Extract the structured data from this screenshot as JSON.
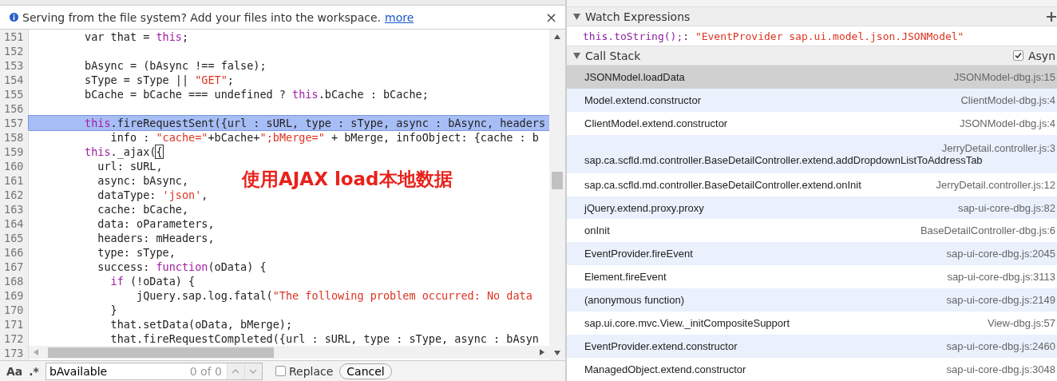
{
  "infobar": {
    "message": "Serving from the file system? Add your files into the workspace.",
    "link": "more",
    "close": "×"
  },
  "editor": {
    "lines": [
      {
        "number": "151",
        "selected": false,
        "tokens": [
          {
            "kind": "plain",
            "text": "        var that = "
          },
          {
            "kind": "keyword",
            "text": "this"
          },
          {
            "kind": "plain",
            "text": ";"
          }
        ]
      },
      {
        "number": "152",
        "selected": false
      },
      {
        "number": "153",
        "selected": false,
        "tokens": [
          {
            "kind": "plain",
            "text": "        bAsync = (bAsync !== false);"
          }
        ]
      },
      {
        "number": "154",
        "selected": false,
        "tokens": [
          {
            "kind": "plain",
            "text": "        sType = sType || "
          },
          {
            "kind": "string",
            "text": "\"GET\""
          },
          {
            "kind": "plain",
            "text": ";"
          }
        ]
      },
      {
        "number": "155",
        "selected": false,
        "tokens": [
          {
            "kind": "plain",
            "text": "        bCache = bCache === undefined ? "
          },
          {
            "kind": "keyword",
            "text": "this"
          },
          {
            "kind": "plain",
            "text": ".bCache : bCache;"
          }
        ]
      },
      {
        "number": "156",
        "selected": false
      },
      {
        "number": "157",
        "selected": true,
        "tokens": [
          {
            "kind": "keyword",
            "text": "        this"
          },
          {
            "kind": "plain",
            "text": ".fireRequestSent({url : sURL, type : sType, async : bAsync, headers"
          }
        ]
      },
      {
        "number": "158",
        "selected": false,
        "tokens": [
          {
            "kind": "plain",
            "text": "            info : "
          },
          {
            "kind": "string",
            "text": "\"cache=\""
          },
          {
            "kind": "plain",
            "text": "+bCache+"
          },
          {
            "kind": "string",
            "text": "\";bMerge=\""
          },
          {
            "kind": "plain",
            "text": " + bMerge, infoObject: {cache : b"
          }
        ]
      },
      {
        "number": "159",
        "selected": false,
        "tokens": [
          {
            "kind": "keyword",
            "text": "        this"
          },
          {
            "kind": "plain",
            "text": "._ajax("
          },
          {
            "kind": "match",
            "text": "{"
          }
        ]
      },
      {
        "number": "160",
        "selected": false,
        "tokens": [
          {
            "kind": "plain",
            "text": "          url: sURL,"
          }
        ]
      },
      {
        "number": "161",
        "selected": false,
        "tokens": [
          {
            "kind": "plain",
            "text": "          async: bAsync,"
          }
        ]
      },
      {
        "number": "162",
        "selected": false,
        "tokens": [
          {
            "kind": "plain",
            "text": "          dataType: "
          },
          {
            "kind": "string",
            "text": "'json'"
          },
          {
            "kind": "plain",
            "text": ","
          }
        ]
      },
      {
        "number": "163",
        "selected": false,
        "tokens": [
          {
            "kind": "plain",
            "text": "          cache: bCache,"
          }
        ]
      },
      {
        "number": "164",
        "selected": false,
        "tokens": [
          {
            "kind": "plain",
            "text": "          data: oParameters,"
          }
        ]
      },
      {
        "number": "165",
        "selected": false,
        "tokens": [
          {
            "kind": "plain",
            "text": "          headers: mHeaders,"
          }
        ]
      },
      {
        "number": "166",
        "selected": false,
        "tokens": [
          {
            "kind": "plain",
            "text": "          type: sType,"
          }
        ]
      },
      {
        "number": "167",
        "selected": false,
        "tokens": [
          {
            "kind": "plain",
            "text": "          success: "
          },
          {
            "kind": "keyword",
            "text": "function"
          },
          {
            "kind": "plain",
            "text": "(oData) {"
          }
        ]
      },
      {
        "number": "168",
        "selected": false,
        "tokens": [
          {
            "kind": "keyword",
            "text": "            if"
          },
          {
            "kind": "plain",
            "text": " (!oData) {"
          }
        ]
      },
      {
        "number": "169",
        "selected": false,
        "tokens": [
          {
            "kind": "plain",
            "text": "                jQuery.sap.log.fatal("
          },
          {
            "kind": "string",
            "text": "\"The following problem occurred: No data"
          }
        ]
      },
      {
        "number": "170",
        "selected": false,
        "tokens": [
          {
            "kind": "plain",
            "text": "            }"
          }
        ]
      },
      {
        "number": "171",
        "selected": false,
        "tokens": [
          {
            "kind": "plain",
            "text": "            that.setData(oData, bMerge);"
          }
        ]
      },
      {
        "number": "172",
        "selected": false,
        "tokens": [
          {
            "kind": "plain",
            "text": "            that.fireRequestCompleted({url : sURL, type : sType, async : bAsyn"
          }
        ]
      },
      {
        "number": "173",
        "selected": false
      }
    ],
    "annotation": "使用AJAX load本地数据"
  },
  "search": {
    "case_label": "Aa",
    "regex_label": ".*",
    "value": "bAvailable",
    "count": "0 of 0",
    "replace": {
      "label": "Replace",
      "checked": false
    },
    "cancel": "Cancel"
  },
  "watch": {
    "title": "Watch Expressions",
    "expanded": true,
    "expression": "this.toString();",
    "separator": ": ",
    "value": "\"EventProvider sap.ui.model.json.JSONModel\""
  },
  "call_stack": {
    "title": "Call Stack",
    "expanded": true,
    "async": {
      "label": "Asyn",
      "checked": true
    },
    "frames": [
      {
        "function": "JSONModel.loadData",
        "location": "JSONModel-dbg.js:15",
        "selected": true
      },
      {
        "function": "Model.extend.constructor",
        "location": "ClientModel-dbg.js:4",
        "selected": false
      },
      {
        "function": "ClientModel.extend.constructor",
        "location": "JSONModel-dbg.js:4",
        "selected": false
      },
      {
        "function": "sap.ca.scfld.md.controller.BaseDetailController.extend.addDropdownListToAddressTab",
        "location": "JerryDetail.controller.js:3",
        "selected": false
      },
      {
        "function": "sap.ca.scfld.md.controller.BaseDetailController.extend.onInit",
        "location": "JerryDetail.controller.js:12",
        "selected": false
      },
      {
        "function": "jQuery.extend.proxy.proxy",
        "location": "sap-ui-core-dbg.js:82",
        "selected": false
      },
      {
        "function": "onInit",
        "location": "BaseDetailController-dbg.js:6",
        "selected": false
      },
      {
        "function": "EventProvider.fireEvent",
        "location": "sap-ui-core-dbg.js:2045",
        "selected": false
      },
      {
        "function": "Element.fireEvent",
        "location": "sap-ui-core-dbg.js:3113",
        "selected": false
      },
      {
        "function": "(anonymous function)",
        "location": "sap-ui-core-dbg.js:2149",
        "selected": false
      },
      {
        "function": "sap.ui.core.mvc.View._initCompositeSupport",
        "location": "View-dbg.js:57",
        "selected": false
      },
      {
        "function": "EventProvider.extend.constructor",
        "location": "sap-ui-core-dbg.js:2460",
        "selected": false
      },
      {
        "function": "ManagedObject.extend.constructor",
        "location": "sap-ui-core-dbg.js:3048",
        "selected": false
      }
    ]
  }
}
